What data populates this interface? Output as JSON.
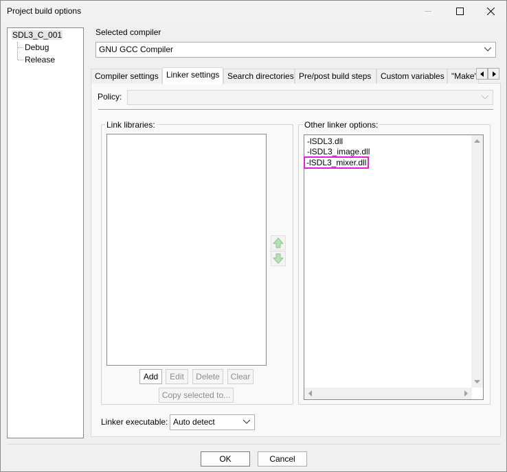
{
  "window": {
    "title": "Project build options"
  },
  "tree": {
    "root": "SDL3_C_001",
    "children": [
      "Debug",
      "Release"
    ]
  },
  "compiler": {
    "label": "Selected compiler",
    "value": "GNU GCC Compiler"
  },
  "tabs": [
    "Compiler settings",
    "Linker settings",
    "Search directories",
    "Pre/post build steps",
    "Custom variables",
    "\"Make\""
  ],
  "active_tab": "Linker settings",
  "policy": {
    "label": "Policy:",
    "value": ""
  },
  "link_libraries": {
    "title": "Link libraries:",
    "buttons": {
      "add": "Add",
      "edit": "Edit",
      "delete": "Delete",
      "clear": "Clear",
      "copy": "Copy selected to..."
    }
  },
  "other_options": {
    "title": "Other linker options:",
    "lines": [
      "-lSDL3.dll",
      "-lSDL3_image.dll",
      "-lSDL3_mixer.dll"
    ],
    "highlight_color": "#e020d0"
  },
  "linker_exe": {
    "label": "Linker executable:",
    "value": "Auto detect"
  },
  "footer": {
    "ok": "OK",
    "cancel": "Cancel"
  },
  "colors": {
    "arrow_green": "#7cc47c"
  }
}
